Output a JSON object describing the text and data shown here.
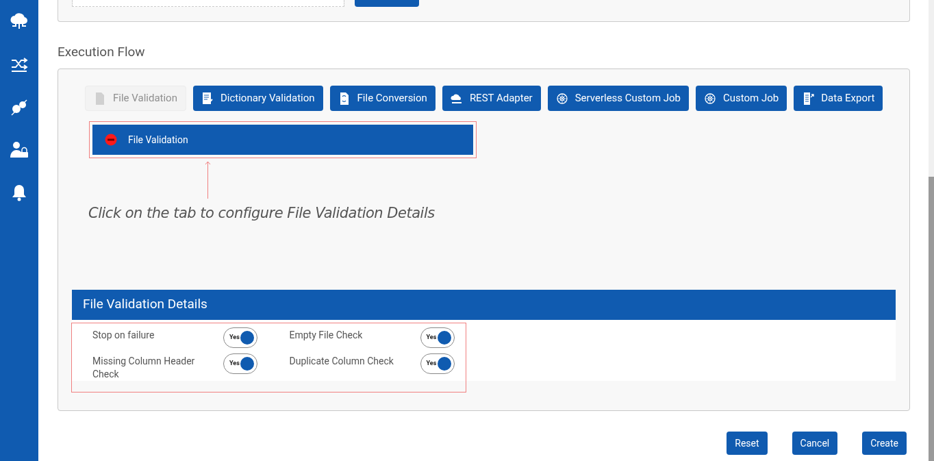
{
  "section_title": "Execution Flow",
  "palette": [
    {
      "label": "File Validation",
      "disabled": true,
      "kind": "doc"
    },
    {
      "label": "Dictionary Validation",
      "disabled": false,
      "kind": "checklist"
    },
    {
      "label": "File Conversion",
      "disabled": false,
      "kind": "convert"
    },
    {
      "label": "REST Adapter",
      "disabled": false,
      "kind": "cloud"
    },
    {
      "label": "Serverless Custom Job",
      "disabled": false,
      "kind": "wheel"
    },
    {
      "label": "Custom Job",
      "disabled": false,
      "kind": "wheel"
    },
    {
      "label": "Data Export",
      "disabled": false,
      "kind": "export"
    }
  ],
  "flow_steps": [
    {
      "label": "File Validation"
    }
  ],
  "hint": "Click on the tab to configure File Validation Details",
  "details": {
    "title": "File Validation Details",
    "options": [
      {
        "label": "Stop on failure",
        "toggle_text": "Yes",
        "on": true
      },
      {
        "label": "Empty File Check",
        "toggle_text": "Yes",
        "on": true
      },
      {
        "label": "Missing Column Header Check",
        "toggle_text": "Yes",
        "on": true
      },
      {
        "label": "Duplicate Column Check",
        "toggle_text": "Yes",
        "on": true
      }
    ]
  },
  "footer_buttons": [
    "Reset",
    "Cancel",
    "Create"
  ]
}
